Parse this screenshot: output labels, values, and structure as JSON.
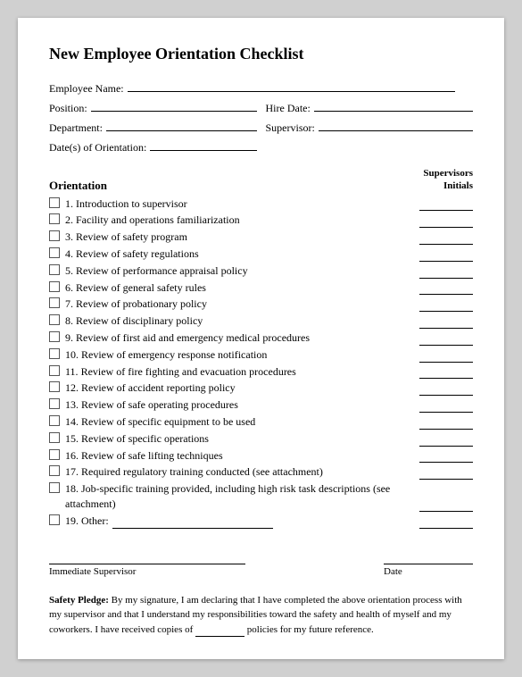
{
  "title": "New Employee Orientation Checklist",
  "fields": {
    "employee_name_label": "Employee Name:",
    "position_label": "Position:",
    "hire_date_label": "Hire Date:",
    "department_label": "Department:",
    "supervisor_label": "Supervisor:",
    "dates_label": "Date(s) of Orientation:"
  },
  "checklist": {
    "orientation_label": "Orientation",
    "supervisors_initials_line1": "Supervisors",
    "supervisors_initials_line2": "Initials",
    "items": [
      {
        "num": "1.",
        "text": "Introduction to supervisor"
      },
      {
        "num": "2.",
        "text": "Facility and operations familiarization"
      },
      {
        "num": "3.",
        "text": "Review of safety program"
      },
      {
        "num": "4.",
        "text": "Review of safety regulations"
      },
      {
        "num": "5.",
        "text": "Review of performance appraisal policy"
      },
      {
        "num": "6.",
        "text": "Review of general safety rules"
      },
      {
        "num": "7.",
        "text": "Review of probationary policy"
      },
      {
        "num": "8.",
        "text": "Review of disciplinary policy"
      },
      {
        "num": "9.",
        "text": "Review of first aid and emergency medical procedures"
      },
      {
        "num": "10.",
        "text": "Review of emergency response notification"
      },
      {
        "num": "11.",
        "text": "Review of fire fighting and evacuation procedures"
      },
      {
        "num": "12.",
        "text": "Review of accident reporting policy"
      },
      {
        "num": "13.",
        "text": "Review of safe operating procedures"
      },
      {
        "num": "14.",
        "text": "Review of specific equipment to be used"
      },
      {
        "num": "15.",
        "text": "Review of specific operations"
      },
      {
        "num": "16.",
        "text": "Review of safe lifting techniques"
      },
      {
        "num": "17.",
        "text": "Required regulatory training conducted (see attachment)"
      },
      {
        "num": "18.",
        "text": "Job-specific training provided, including high risk task descriptions (see attachment)"
      },
      {
        "num": "19.",
        "text": "Other:"
      }
    ]
  },
  "signature": {
    "supervisor_label": "Immediate Supervisor",
    "date_label": "Date"
  },
  "safety_pledge": {
    "label": "Safety Pledge:",
    "text": "By my signature, I am declaring that I have completed the above orientation process with my supervisor and that I understand my responsibilities toward the safety and health of myself and my coworkers. I have received copies of",
    "text2": "policies for my future reference."
  }
}
